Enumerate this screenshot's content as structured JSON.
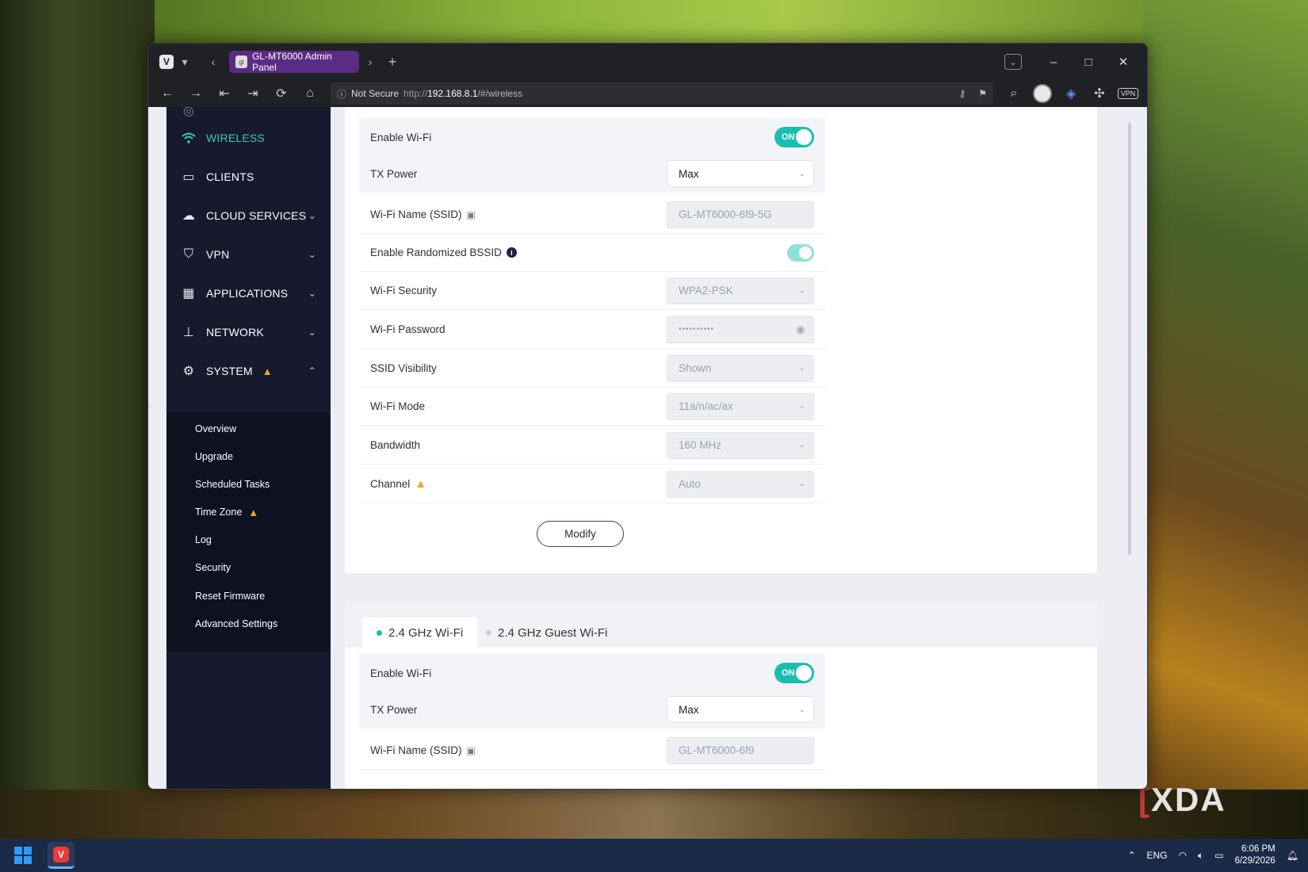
{
  "browser": {
    "tab_title": "GL-MT6000 Admin Panel",
    "tab_favicon": "gl",
    "security_label": "Not Secure",
    "url_prefix": "http://",
    "url_host": "192.168.8.1",
    "url_path": "/#/wireless",
    "vpn_label": "VPN"
  },
  "sidebar": {
    "items": [
      {
        "label": "WIRELESS",
        "icon": "wifi-icon",
        "active": true
      },
      {
        "label": "CLIENTS",
        "icon": "devices-icon"
      },
      {
        "label": "CLOUD SERVICES",
        "icon": "cloud-icon"
      },
      {
        "label": "VPN",
        "icon": "shield-icon"
      },
      {
        "label": "APPLICATIONS",
        "icon": "grid-icon"
      },
      {
        "label": "NETWORK",
        "icon": "network-icon"
      },
      {
        "label": "SYSTEM",
        "icon": "gear-icon",
        "warning": true
      }
    ],
    "system_sub": [
      "Overview",
      "Upgrade",
      "Scheduled Tasks",
      "Time Zone",
      "Log",
      "Security",
      "Reset Firmware",
      "Advanced Settings"
    ]
  },
  "card1": {
    "rows": {
      "enable_wifi": {
        "label": "Enable Wi-Fi",
        "toggle": "ON"
      },
      "tx_power": {
        "label": "TX Power",
        "value": "Max"
      },
      "ssid": {
        "label": "Wi-Fi Name (SSID)",
        "value": "GL-MT6000-6f9-5G"
      },
      "randomized_bssid": {
        "label": "Enable Randomized BSSID"
      },
      "security": {
        "label": "Wi-Fi Security",
        "value": "WPA2-PSK"
      },
      "password": {
        "label": "Wi-Fi Password",
        "value": "••••••••••"
      },
      "ssid_visibility": {
        "label": "SSID Visibility",
        "value": "Shown"
      },
      "mode": {
        "label": "Wi-Fi Mode",
        "value": "11a/n/ac/ax"
      },
      "bandwidth": {
        "label": "Bandwidth",
        "value": "160 MHz"
      },
      "channel": {
        "label": "Channel",
        "value": "Auto"
      }
    },
    "modify_label": "Modify"
  },
  "card2": {
    "tabs": [
      {
        "label": "2.4 GHz Wi-Fi",
        "active": true
      },
      {
        "label": "2.4 GHz Guest Wi-Fi",
        "active": false
      }
    ],
    "rows": {
      "enable_wifi": {
        "label": "Enable Wi-Fi",
        "toggle": "ON"
      },
      "tx_power": {
        "label": "TX Power",
        "value": "Max"
      },
      "ssid": {
        "label": "Wi-Fi Name (SSID)",
        "value": "GL-MT6000-6f9"
      }
    }
  },
  "taskbar": {
    "language": "ENG",
    "time": "6:06 PM",
    "date": "6/29/2026"
  },
  "watermark": "XDA",
  "colors": {
    "accent": "#19bfae",
    "sidebar_bg": "#161a2c",
    "warning": "#f2a81d",
    "tab_purple": "#5b2b85"
  }
}
